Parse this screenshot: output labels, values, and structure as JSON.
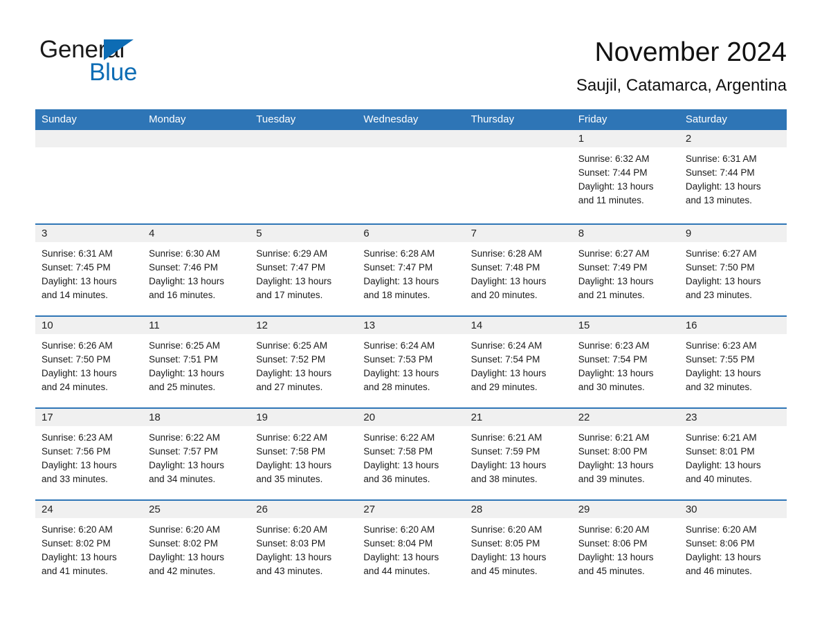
{
  "brand": {
    "name_part1": "General",
    "name_part2": "Blue",
    "triangle_color": "#0d6cb4"
  },
  "header": {
    "month_title": "November 2024",
    "location": "Saujil, Catamarca, Argentina"
  },
  "theme": {
    "header_blue": "#2e75b6",
    "day_band_gray": "#f0f0f0",
    "body_white": "#ffffff",
    "text_dark": "#1a1a1a"
  },
  "weekdays": [
    "Sunday",
    "Monday",
    "Tuesday",
    "Wednesday",
    "Thursday",
    "Friday",
    "Saturday"
  ],
  "weeks": [
    [
      {
        "day": "",
        "empty": true
      },
      {
        "day": "",
        "empty": true
      },
      {
        "day": "",
        "empty": true
      },
      {
        "day": "",
        "empty": true
      },
      {
        "day": "",
        "empty": true
      },
      {
        "day": "1",
        "sunrise": "Sunrise: 6:32 AM",
        "sunset": "Sunset: 7:44 PM",
        "daylight1": "Daylight: 13 hours",
        "daylight2": "and 11 minutes."
      },
      {
        "day": "2",
        "sunrise": "Sunrise: 6:31 AM",
        "sunset": "Sunset: 7:44 PM",
        "daylight1": "Daylight: 13 hours",
        "daylight2": "and 13 minutes."
      }
    ],
    [
      {
        "day": "3",
        "sunrise": "Sunrise: 6:31 AM",
        "sunset": "Sunset: 7:45 PM",
        "daylight1": "Daylight: 13 hours",
        "daylight2": "and 14 minutes."
      },
      {
        "day": "4",
        "sunrise": "Sunrise: 6:30 AM",
        "sunset": "Sunset: 7:46 PM",
        "daylight1": "Daylight: 13 hours",
        "daylight2": "and 16 minutes."
      },
      {
        "day": "5",
        "sunrise": "Sunrise: 6:29 AM",
        "sunset": "Sunset: 7:47 PM",
        "daylight1": "Daylight: 13 hours",
        "daylight2": "and 17 minutes."
      },
      {
        "day": "6",
        "sunrise": "Sunrise: 6:28 AM",
        "sunset": "Sunset: 7:47 PM",
        "daylight1": "Daylight: 13 hours",
        "daylight2": "and 18 minutes."
      },
      {
        "day": "7",
        "sunrise": "Sunrise: 6:28 AM",
        "sunset": "Sunset: 7:48 PM",
        "daylight1": "Daylight: 13 hours",
        "daylight2": "and 20 minutes."
      },
      {
        "day": "8",
        "sunrise": "Sunrise: 6:27 AM",
        "sunset": "Sunset: 7:49 PM",
        "daylight1": "Daylight: 13 hours",
        "daylight2": "and 21 minutes."
      },
      {
        "day": "9",
        "sunrise": "Sunrise: 6:27 AM",
        "sunset": "Sunset: 7:50 PM",
        "daylight1": "Daylight: 13 hours",
        "daylight2": "and 23 minutes."
      }
    ],
    [
      {
        "day": "10",
        "sunrise": "Sunrise: 6:26 AM",
        "sunset": "Sunset: 7:50 PM",
        "daylight1": "Daylight: 13 hours",
        "daylight2": "and 24 minutes."
      },
      {
        "day": "11",
        "sunrise": "Sunrise: 6:25 AM",
        "sunset": "Sunset: 7:51 PM",
        "daylight1": "Daylight: 13 hours",
        "daylight2": "and 25 minutes."
      },
      {
        "day": "12",
        "sunrise": "Sunrise: 6:25 AM",
        "sunset": "Sunset: 7:52 PM",
        "daylight1": "Daylight: 13 hours",
        "daylight2": "and 27 minutes."
      },
      {
        "day": "13",
        "sunrise": "Sunrise: 6:24 AM",
        "sunset": "Sunset: 7:53 PM",
        "daylight1": "Daylight: 13 hours",
        "daylight2": "and 28 minutes."
      },
      {
        "day": "14",
        "sunrise": "Sunrise: 6:24 AM",
        "sunset": "Sunset: 7:54 PM",
        "daylight1": "Daylight: 13 hours",
        "daylight2": "and 29 minutes."
      },
      {
        "day": "15",
        "sunrise": "Sunrise: 6:23 AM",
        "sunset": "Sunset: 7:54 PM",
        "daylight1": "Daylight: 13 hours",
        "daylight2": "and 30 minutes."
      },
      {
        "day": "16",
        "sunrise": "Sunrise: 6:23 AM",
        "sunset": "Sunset: 7:55 PM",
        "daylight1": "Daylight: 13 hours",
        "daylight2": "and 32 minutes."
      }
    ],
    [
      {
        "day": "17",
        "sunrise": "Sunrise: 6:23 AM",
        "sunset": "Sunset: 7:56 PM",
        "daylight1": "Daylight: 13 hours",
        "daylight2": "and 33 minutes."
      },
      {
        "day": "18",
        "sunrise": "Sunrise: 6:22 AM",
        "sunset": "Sunset: 7:57 PM",
        "daylight1": "Daylight: 13 hours",
        "daylight2": "and 34 minutes."
      },
      {
        "day": "19",
        "sunrise": "Sunrise: 6:22 AM",
        "sunset": "Sunset: 7:58 PM",
        "daylight1": "Daylight: 13 hours",
        "daylight2": "and 35 minutes."
      },
      {
        "day": "20",
        "sunrise": "Sunrise: 6:22 AM",
        "sunset": "Sunset: 7:58 PM",
        "daylight1": "Daylight: 13 hours",
        "daylight2": "and 36 minutes."
      },
      {
        "day": "21",
        "sunrise": "Sunrise: 6:21 AM",
        "sunset": "Sunset: 7:59 PM",
        "daylight1": "Daylight: 13 hours",
        "daylight2": "and 38 minutes."
      },
      {
        "day": "22",
        "sunrise": "Sunrise: 6:21 AM",
        "sunset": "Sunset: 8:00 PM",
        "daylight1": "Daylight: 13 hours",
        "daylight2": "and 39 minutes."
      },
      {
        "day": "23",
        "sunrise": "Sunrise: 6:21 AM",
        "sunset": "Sunset: 8:01 PM",
        "daylight1": "Daylight: 13 hours",
        "daylight2": "and 40 minutes."
      }
    ],
    [
      {
        "day": "24",
        "sunrise": "Sunrise: 6:20 AM",
        "sunset": "Sunset: 8:02 PM",
        "daylight1": "Daylight: 13 hours",
        "daylight2": "and 41 minutes."
      },
      {
        "day": "25",
        "sunrise": "Sunrise: 6:20 AM",
        "sunset": "Sunset: 8:02 PM",
        "daylight1": "Daylight: 13 hours",
        "daylight2": "and 42 minutes."
      },
      {
        "day": "26",
        "sunrise": "Sunrise: 6:20 AM",
        "sunset": "Sunset: 8:03 PM",
        "daylight1": "Daylight: 13 hours",
        "daylight2": "and 43 minutes."
      },
      {
        "day": "27",
        "sunrise": "Sunrise: 6:20 AM",
        "sunset": "Sunset: 8:04 PM",
        "daylight1": "Daylight: 13 hours",
        "daylight2": "and 44 minutes."
      },
      {
        "day": "28",
        "sunrise": "Sunrise: 6:20 AM",
        "sunset": "Sunset: 8:05 PM",
        "daylight1": "Daylight: 13 hours",
        "daylight2": "and 45 minutes."
      },
      {
        "day": "29",
        "sunrise": "Sunrise: 6:20 AM",
        "sunset": "Sunset: 8:06 PM",
        "daylight1": "Daylight: 13 hours",
        "daylight2": "and 45 minutes."
      },
      {
        "day": "30",
        "sunrise": "Sunrise: 6:20 AM",
        "sunset": "Sunset: 8:06 PM",
        "daylight1": "Daylight: 13 hours",
        "daylight2": "and 46 minutes."
      }
    ]
  ]
}
